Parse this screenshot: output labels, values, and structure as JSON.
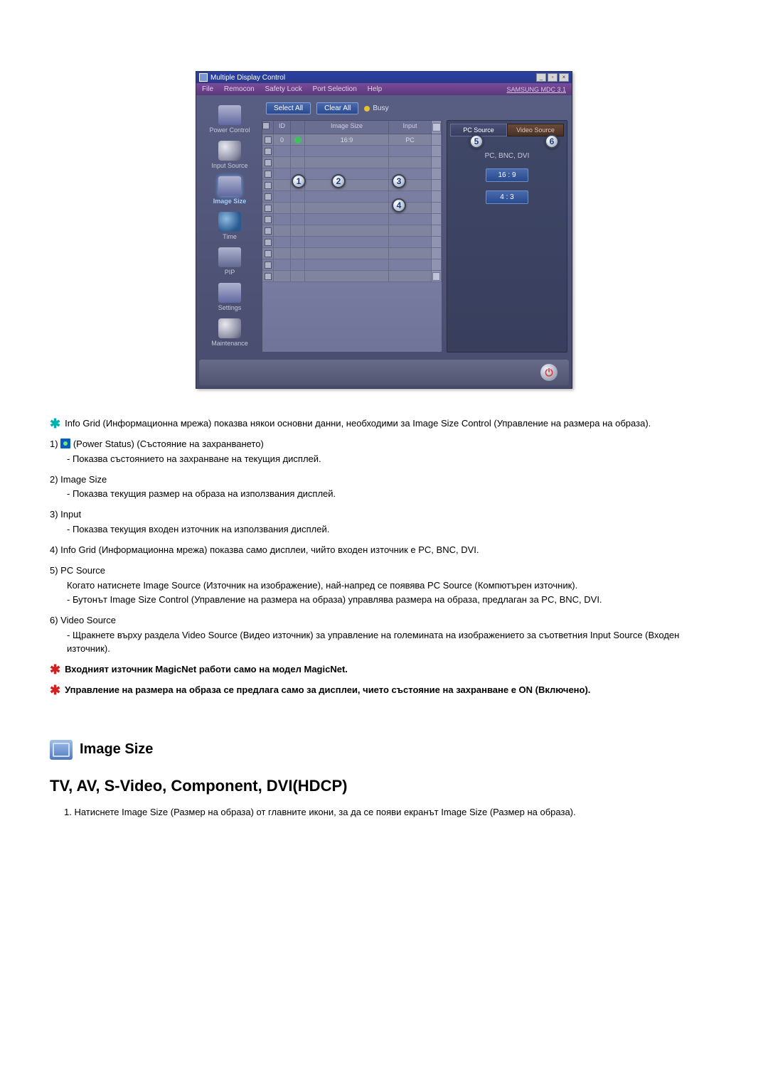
{
  "app": {
    "title": "Multiple Display Control",
    "menu": [
      "File",
      "Remocon",
      "Safety Lock",
      "Port Selection",
      "Help"
    ],
    "brand": "SAMSUNG MDC 3.1",
    "win_controls": [
      "_",
      "▫",
      "×"
    ]
  },
  "sidebar": {
    "items": [
      {
        "label": "Power Control"
      },
      {
        "label": "Input Source"
      },
      {
        "label": "Image Size",
        "selected": true
      },
      {
        "label": "Time"
      },
      {
        "label": "PIP"
      },
      {
        "label": "Settings"
      },
      {
        "label": "Maintenance"
      }
    ]
  },
  "toolbar": {
    "select_all": "Select All",
    "clear_all": "Clear All",
    "busy": "Busy"
  },
  "grid": {
    "headers": {
      "id": "ID",
      "image_size": "Image Size",
      "input": "Input"
    },
    "first_row": {
      "id": "0",
      "image_size": "16:9",
      "input": "PC"
    }
  },
  "side_panel": {
    "tabs": {
      "pc": "PC Source",
      "video": "Video Source"
    },
    "device_label": "PC, BNC, DVI",
    "ratio1": "16 : 9",
    "ratio2": "4 : 3"
  },
  "callouts": {
    "c1": "1",
    "c2": "2",
    "c3": "3",
    "c4": "4",
    "c5": "5",
    "c6": "6"
  },
  "notes": {
    "intro": "Info Grid (Информационна мрежа) показва някои основни данни, необходими за Image Size Control (Управление на размера на образа).",
    "i1_lead": "1)",
    "i1_label": "(Power Status) (Състояние на захранването)",
    "i1_sub": "- Показва състоянието на захранване на текущия дисплей.",
    "i2_lead": "2)  Image Size",
    "i2_sub": "- Показва текущия размер на образа на използвания дисплей.",
    "i3_lead": "3)  Input",
    "i3_sub": "- Показва текущия входен източник на използвания дисплей.",
    "i4": "4)  Info Grid (Информационна мрежа) показва само дисплеи, чийто входен източник е PC, BNC, DVI.",
    "i5_lead": "5)  PC Source",
    "i5_sub1": "Когато натиснете Image Source (Източник на изображение), най-напред се появява PC Source (Компютърен източник).",
    "i5_sub2": "- Бутонът Image Size Control (Управление на размера на образа) управлява размера на образа, предлаган за PC, BNC, DVI.",
    "i6_lead": "6)  Video Source",
    "i6_sub": "- Щракнете върху раздела Video Source (Видео източник) за управление на големината на изображението за съответния Input Source (Входен източник).",
    "warn1": "Входният източник MagicNet работи само на модел MagicNet.",
    "warn2": "Управление на размера на образа се предлага само за дисплеи, чието състояние на захранване е ON (Включено)."
  },
  "section2": {
    "title": "Image Size",
    "subheading": "TV, AV, S-Video, Component, DVI(HDCP)",
    "step1": "1.  Натиснете Image Size (Размер на образа) от главните икони, за да се появи екранът Image Size (Размер на образа)."
  }
}
